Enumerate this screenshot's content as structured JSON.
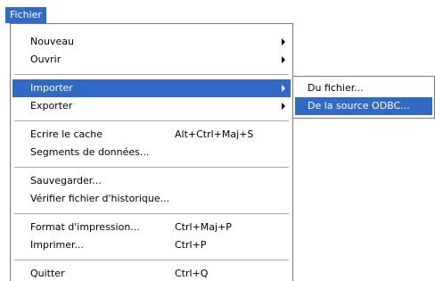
{
  "menu_title": "Fichier",
  "menu_items": [
    {
      "label": "Nouveau",
      "shortcut": "",
      "has_submenu": true
    },
    {
      "label": "Ouvrir",
      "shortcut": "",
      "has_submenu": true
    },
    {
      "label": "Importer",
      "shortcut": "",
      "has_submenu": true,
      "selected": true
    },
    {
      "label": "Exporter",
      "shortcut": "",
      "has_submenu": true
    },
    {
      "label": "Ecrire le cache",
      "shortcut": "Alt+Ctrl+Maj+S"
    },
    {
      "label": "Segments de données...",
      "shortcut": ""
    },
    {
      "label": "Sauvegarder...",
      "shortcut": ""
    },
    {
      "label": "Vérifier fichier d'historique...",
      "shortcut": ""
    },
    {
      "label": "Format d'impression...",
      "shortcut": "Ctrl+Maj+P"
    },
    {
      "label": "Imprimer...",
      "shortcut": "Ctrl+P"
    },
    {
      "label": "Quitter",
      "shortcut": "Ctrl+Q"
    }
  ],
  "submenu_items": [
    {
      "label": "Du fichier..."
    },
    {
      "label": "De la source ODBC...",
      "selected": true
    }
  ],
  "colors": {
    "highlight": "#316ac5",
    "highlight_text": "#ffffff",
    "border": "#7a7a7a"
  }
}
